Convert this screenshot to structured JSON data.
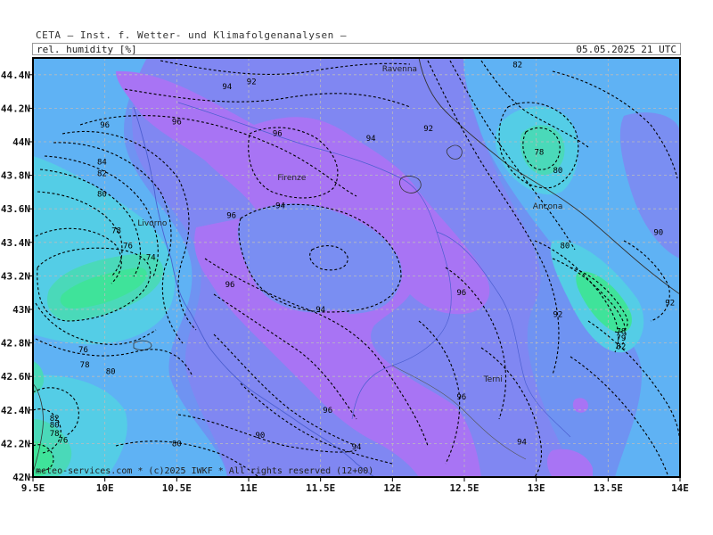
{
  "header": {
    "model": "CETA — Inst. f. Wetter- und Klimafolgenanalysen —",
    "variable": "rel. humidity [%]",
    "datetime": "05.05.2025 21 UTC"
  },
  "chart_data": {
    "type": "contour-map",
    "xlim": [
      9.5,
      14
    ],
    "ylim": [
      42,
      44.5
    ],
    "x_ticks": [
      {
        "v": 9.5,
        "label": "9.5E"
      },
      {
        "v": 10,
        "label": "10E"
      },
      {
        "v": 10.5,
        "label": "10.5E"
      },
      {
        "v": 11,
        "label": "11E"
      },
      {
        "v": 11.5,
        "label": "11.5E"
      },
      {
        "v": 12,
        "label": "12E"
      },
      {
        "v": 12.5,
        "label": "12.5E"
      },
      {
        "v": 13,
        "label": "13E"
      },
      {
        "v": 13.5,
        "label": "13.5E"
      },
      {
        "v": 14,
        "label": "14E"
      }
    ],
    "y_ticks": [
      {
        "v": 42,
        "label": "42N"
      },
      {
        "v": 42.2,
        "label": "42.2N"
      },
      {
        "v": 42.4,
        "label": "42.4N"
      },
      {
        "v": 42.6,
        "label": "42.6N"
      },
      {
        "v": 42.8,
        "label": "42.8N"
      },
      {
        "v": 43,
        "label": "43N"
      },
      {
        "v": 43.2,
        "label": "43.2N"
      },
      {
        "v": 43.4,
        "label": "43.4N"
      },
      {
        "v": 43.6,
        "label": "43.6N"
      },
      {
        "v": 43.8,
        "label": "43.8N"
      },
      {
        "v": 44,
        "label": "44N"
      },
      {
        "v": 44.2,
        "label": "44.2N"
      },
      {
        "v": 44.4,
        "label": "44.4N"
      }
    ],
    "grid": true,
    "cities": [
      {
        "name": "Ravenna",
        "lon": 12.05,
        "lat": 44.42
      },
      {
        "name": "Firenze",
        "lon": 11.3,
        "lat": 43.77
      },
      {
        "name": "Livorno",
        "lon": 10.33,
        "lat": 43.5
      },
      {
        "name": "Ancona",
        "lon": 13.08,
        "lat": 43.6
      },
      {
        "name": "Terni",
        "lon": 12.7,
        "lat": 42.57
      }
    ],
    "contour_labels": [
      {
        "text": "94",
        "lon": 10.85,
        "lat": 44.33
      },
      {
        "text": "92",
        "lon": 11.02,
        "lat": 44.36
      },
      {
        "text": "96",
        "lon": 10.0,
        "lat": 44.1
      },
      {
        "text": "96",
        "lon": 10.5,
        "lat": 44.12
      },
      {
        "text": "96",
        "lon": 11.2,
        "lat": 44.05
      },
      {
        "text": "94",
        "lon": 11.85,
        "lat": 44.02
      },
      {
        "text": "92",
        "lon": 12.25,
        "lat": 44.08
      },
      {
        "text": "82",
        "lon": 12.87,
        "lat": 44.46
      },
      {
        "text": "84",
        "lon": 9.98,
        "lat": 43.88
      },
      {
        "text": "82",
        "lon": 9.98,
        "lat": 43.81
      },
      {
        "text": "80",
        "lon": 9.98,
        "lat": 43.69
      },
      {
        "text": "78",
        "lon": 10.08,
        "lat": 43.47
      },
      {
        "text": "76",
        "lon": 10.16,
        "lat": 43.38
      },
      {
        "text": "74",
        "lon": 10.32,
        "lat": 43.31
      },
      {
        "text": "96",
        "lon": 10.88,
        "lat": 43.56
      },
      {
        "text": "94",
        "lon": 11.22,
        "lat": 43.62
      },
      {
        "text": "96",
        "lon": 10.87,
        "lat": 43.15
      },
      {
        "text": "94",
        "lon": 11.5,
        "lat": 43.0
      },
      {
        "text": "78",
        "lon": 13.02,
        "lat": 43.94
      },
      {
        "text": "80",
        "lon": 13.15,
        "lat": 43.83
      },
      {
        "text": "80",
        "lon": 13.2,
        "lat": 43.38
      },
      {
        "text": "90",
        "lon": 13.85,
        "lat": 43.46
      },
      {
        "text": "92",
        "lon": 13.93,
        "lat": 43.04
      },
      {
        "text": "92",
        "lon": 13.15,
        "lat": 42.97
      },
      {
        "text": "78",
        "lon": 13.59,
        "lat": 42.87
      },
      {
        "text": "79",
        "lon": 13.59,
        "lat": 42.83
      },
      {
        "text": "82",
        "lon": 13.59,
        "lat": 42.78
      },
      {
        "text": "96",
        "lon": 12.48,
        "lat": 43.1
      },
      {
        "text": "96",
        "lon": 12.48,
        "lat": 42.48
      },
      {
        "text": "96",
        "lon": 11.55,
        "lat": 42.4
      },
      {
        "text": "94",
        "lon": 11.75,
        "lat": 42.18
      },
      {
        "text": "90",
        "lon": 11.08,
        "lat": 42.25
      },
      {
        "text": "94",
        "lon": 12.9,
        "lat": 42.21
      },
      {
        "text": "80",
        "lon": 10.5,
        "lat": 42.2
      },
      {
        "text": "76",
        "lon": 9.85,
        "lat": 42.76
      },
      {
        "text": "78",
        "lon": 9.86,
        "lat": 42.67
      },
      {
        "text": "80",
        "lon": 10.04,
        "lat": 42.63
      },
      {
        "text": "82",
        "lon": 9.65,
        "lat": 42.35
      },
      {
        "text": "80",
        "lon": 9.65,
        "lat": 42.31
      },
      {
        "text": "78",
        "lon": 9.65,
        "lat": 42.26
      },
      {
        "text": "76",
        "lon": 9.71,
        "lat": 42.22
      }
    ]
  },
  "copyright": "meteo-services.com * (c)2025 IWKF * All rights reserved (12+00)",
  "colors": {
    "purple": "#a874f4",
    "violet_blue": "#8087f2",
    "blue": "#6f93f2",
    "light_blue": "#5fb2f4",
    "cyan": "#54cde6",
    "teal": "#4ad9b9",
    "green": "#3fe39a"
  }
}
